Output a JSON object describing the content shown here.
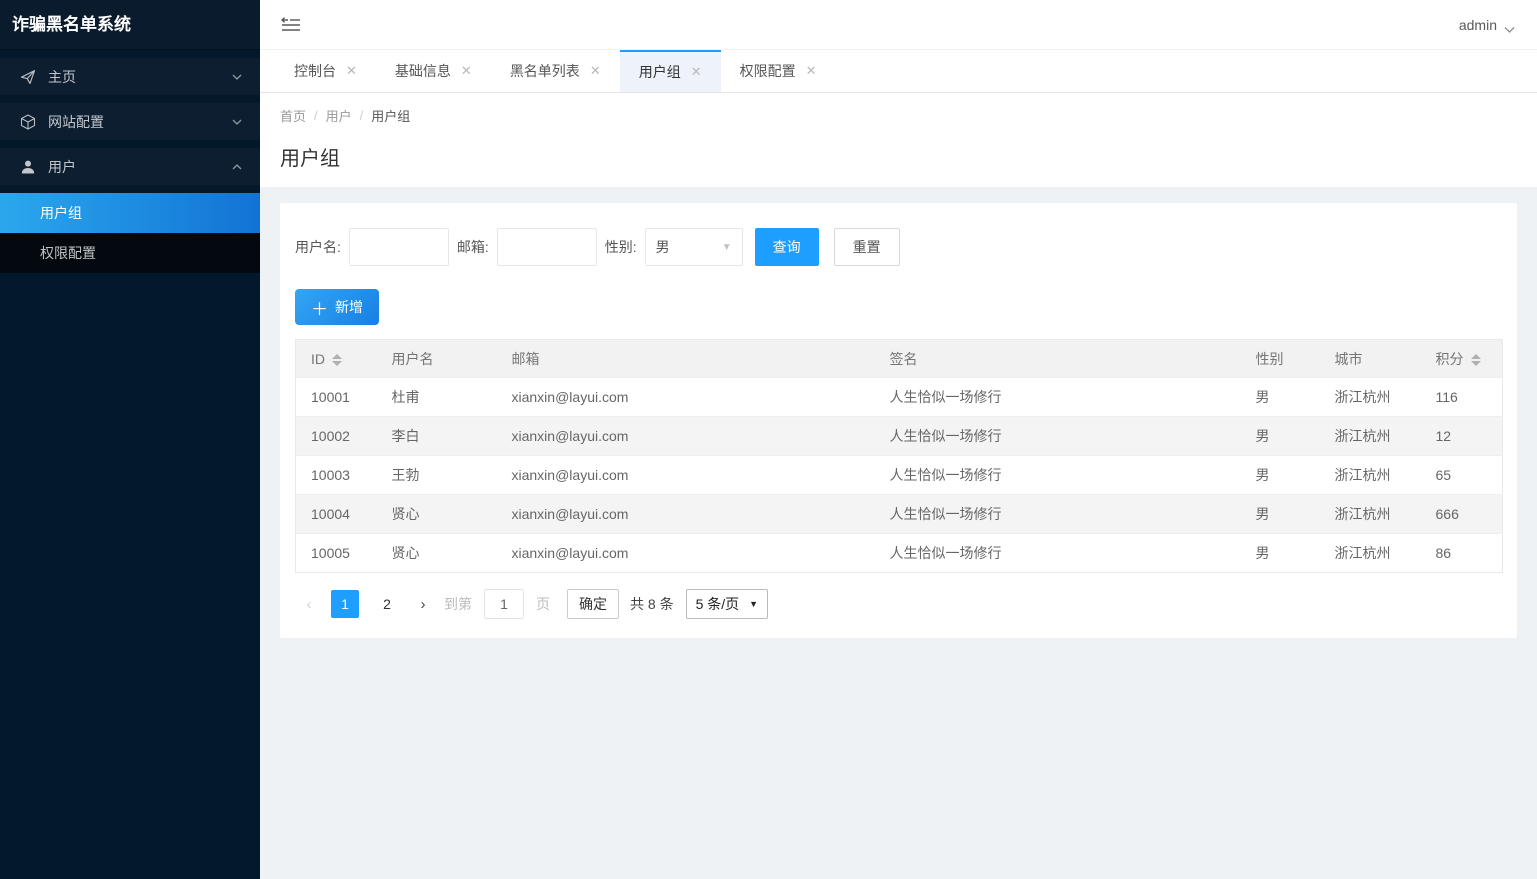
{
  "app": {
    "title": "诈骗黑名单系统",
    "user": "admin"
  },
  "colors": {
    "accent": "#1e9fff",
    "sidebar_bg": "#04182b",
    "selected_gradient_start": "#2ba7ee",
    "selected_gradient_end": "#1273d4",
    "active_tab_bg": "#eef3fb"
  },
  "icons": {
    "collapse": "collapse-left-lines",
    "admin_chevron": "chevron-down",
    "home": "paper-plane",
    "site": "cube",
    "user": "person",
    "chevron_collapsed": "chevron-down",
    "chevron_expanded": "chevron-up",
    "tab_close": "×",
    "sort": "up-down-triangles",
    "select_arrow": "▼",
    "plus": "＋"
  },
  "sidebar": {
    "items": [
      {
        "label": "主页"
      },
      {
        "label": "网站配置"
      },
      {
        "label": "用户"
      }
    ],
    "children": [
      {
        "label": "用户组",
        "active": true
      },
      {
        "label": "权限配置",
        "active": false
      }
    ]
  },
  "tabs": [
    {
      "label": "控制台"
    },
    {
      "label": "基础信息"
    },
    {
      "label": "黑名单列表"
    },
    {
      "label": "用户组",
      "active": true
    },
    {
      "label": "权限配置"
    }
  ],
  "breadcrumb": {
    "items": [
      "首页",
      "用户",
      "用户组"
    ],
    "separator": "/"
  },
  "page": {
    "title": "用户组"
  },
  "search": {
    "username_label": "用户名:",
    "email_label": "邮箱:",
    "gender_label": "性别:",
    "gender_value": "男",
    "search_button": "查询",
    "reset_button": "重置"
  },
  "toolbar": {
    "add_button": "新增"
  },
  "table": {
    "columns": [
      "ID",
      "用户名",
      "邮箱",
      "签名",
      "性别",
      "城市",
      "积分"
    ],
    "sortable_columns": [
      "ID",
      "积分"
    ],
    "rows": [
      [
        "10001",
        "杜甫",
        "xianxin@layui.com",
        "人生恰似一场修行",
        "男",
        "浙江杭州",
        "116"
      ],
      [
        "10002",
        "李白",
        "xianxin@layui.com",
        "人生恰似一场修行",
        "男",
        "浙江杭州",
        "12"
      ],
      [
        "10003",
        "王勃",
        "xianxin@layui.com",
        "人生恰似一场修行",
        "男",
        "浙江杭州",
        "65"
      ],
      [
        "10004",
        "贤心",
        "xianxin@layui.com",
        "人生恰似一场修行",
        "男",
        "浙江杭州",
        "666"
      ],
      [
        "10005",
        "贤心",
        "xianxin@layui.com",
        "人生恰似一场修行",
        "男",
        "浙江杭州",
        "86"
      ]
    ]
  },
  "pagination": {
    "prev": "‹",
    "next": "›",
    "pages": [
      "1",
      "2"
    ],
    "current": "1",
    "goto_label": "到第",
    "goto_value": "1",
    "page_unit": "页",
    "confirm_button": "确定",
    "total_text": "共 8 条",
    "page_size": "5 条/页"
  }
}
